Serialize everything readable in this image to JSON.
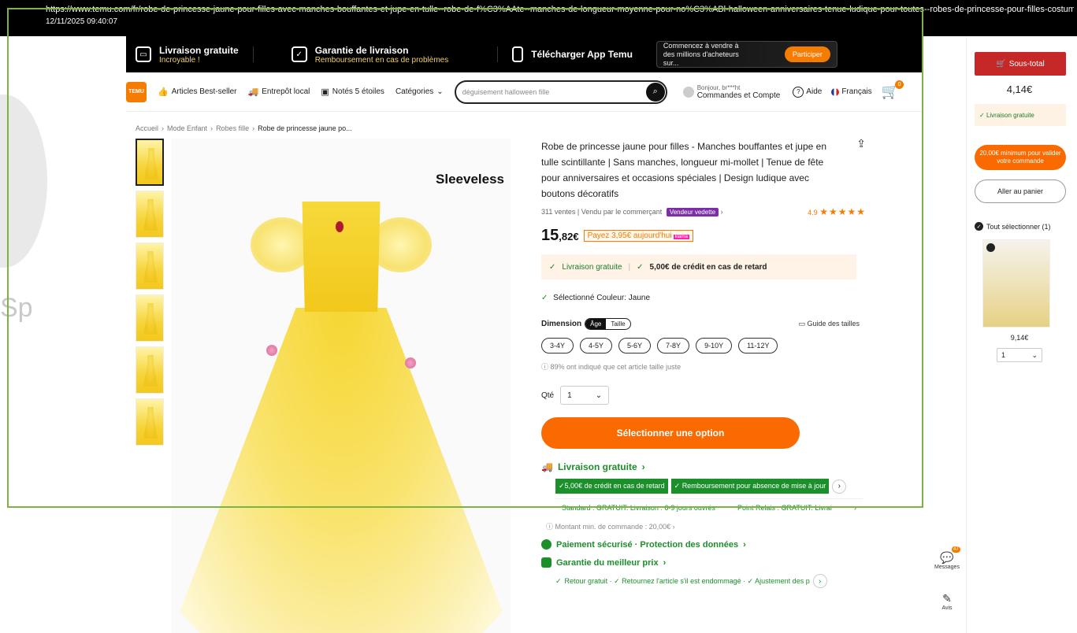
{
  "overlay": {
    "url": "https://www.temu.com/fr/robe-de-princesse-jaune-pour-filles-avec-manches-bouffantes-et-jupe-en-tulle--robe-de-f%C3%AAte--manches-de-longueur-moyenne-pour-no%C3%ABl-halloween-anniversaires-tenue-ludique-pour-toutes--robes-de-princesse-pour-filles-costum",
    "timestamp": "12/11/2025  09:40:07"
  },
  "watermark": {
    "text": "Sp"
  },
  "promo": {
    "free_delivery": "Livraison gratuite",
    "free_delivery_sub": "Incroyable !",
    "guarantee": "Garantie de livraison",
    "guarantee_sub": "Remboursement en cas de problèmes",
    "app": "Télécharger App Temu",
    "sell_text": "Commencez à vendre à des millions d'acheteurs sur...",
    "participate": "Participer"
  },
  "nav": {
    "logo": "TEMU",
    "best_sellers": "Articles Best-seller",
    "local": "Entrepôt local",
    "five_stars": "Notés 5 étoiles",
    "categories": "Catégories",
    "search_placeholder": "déguisement halloween fille",
    "greeting": "Bonjour, br***ht",
    "account": "Commandes et Compte",
    "help": "Aide",
    "language": "Français",
    "cart_count": "0"
  },
  "breadcrumb": {
    "home": "Accueil",
    "sep": "›",
    "kids": "Mode Enfant",
    "dresses": "Robes fille",
    "current": "Robe de princesse jaune po..."
  },
  "image": {
    "badge": "Sleeveless"
  },
  "product": {
    "title": "Robe de princesse jaune pour filles - Manches bouffantes et jupe en tulle scintillante | Sans manches, longueur mi-mollet | Tenue de fête pour anniversaires et occasions spéciales | Design ludique avec boutons décoratifs",
    "sales": "311 ventes",
    "sold_by": "Vendu par le commerçant",
    "vedette": "Vendeur vedette",
    "rating_value": "4.9",
    "stars": "★★★★★",
    "price_int": "15",
    "price_dec": ",82€",
    "pay_today": "Payez 3,95€ aujourd'hui",
    "pay_logo": "klarna",
    "free_ship": "Livraison gratuite",
    "credit": "5,00€ de crédit en cas de retard",
    "colour": "Sélectionné Couleur: Jaune",
    "dimension_label": "Dimension",
    "seg_age": "Âge",
    "seg_size": "Taille",
    "size_guide": "Guide des tailles",
    "sizes": [
      "3-4Y",
      "4-5Y",
      "5-6Y",
      "7-8Y",
      "9-10Y",
      "11-12Y"
    ],
    "fit_note": "89% ont indiqué que cet article taille juste",
    "qty_label": "Qté",
    "qty_value": "1",
    "cta": "Sélectionner une option"
  },
  "shipping": {
    "free_link": "Livraison gratuite",
    "chip_credit": "5,00€ de crédit en cas de retard",
    "chip_refund": "Remboursement pour absence de mise à jour",
    "standard": "Standard : GRATUIT. Livraison : 6-9 jours ouvrés",
    "relay": "Point Relais : GRATUIT. Livrai",
    "min_order": "Montant min. de commande : 20,00€",
    "secure": "Paiement sécurisé · Protection des données",
    "best_price": "Garantie du meilleur prix",
    "returns": "Retour gratuit  ·  ✓ Retournez l'article s'il est endommagé  ·  ✓ Ajustement des p"
  },
  "sidebar": {
    "subtotal_label": "Sous-total",
    "subtotal": "4,14€",
    "free": "Livraison gratuite",
    "min_pill": "20,00€ minimum pour valider votre commande",
    "go_cart": "Aller au panier",
    "select_all": "Tout sélectionner (1)",
    "item_price": "9,14€",
    "item_qty": "1"
  },
  "floating": {
    "messages": "Messages",
    "messages_count": "47",
    "reviews": "Avis"
  }
}
